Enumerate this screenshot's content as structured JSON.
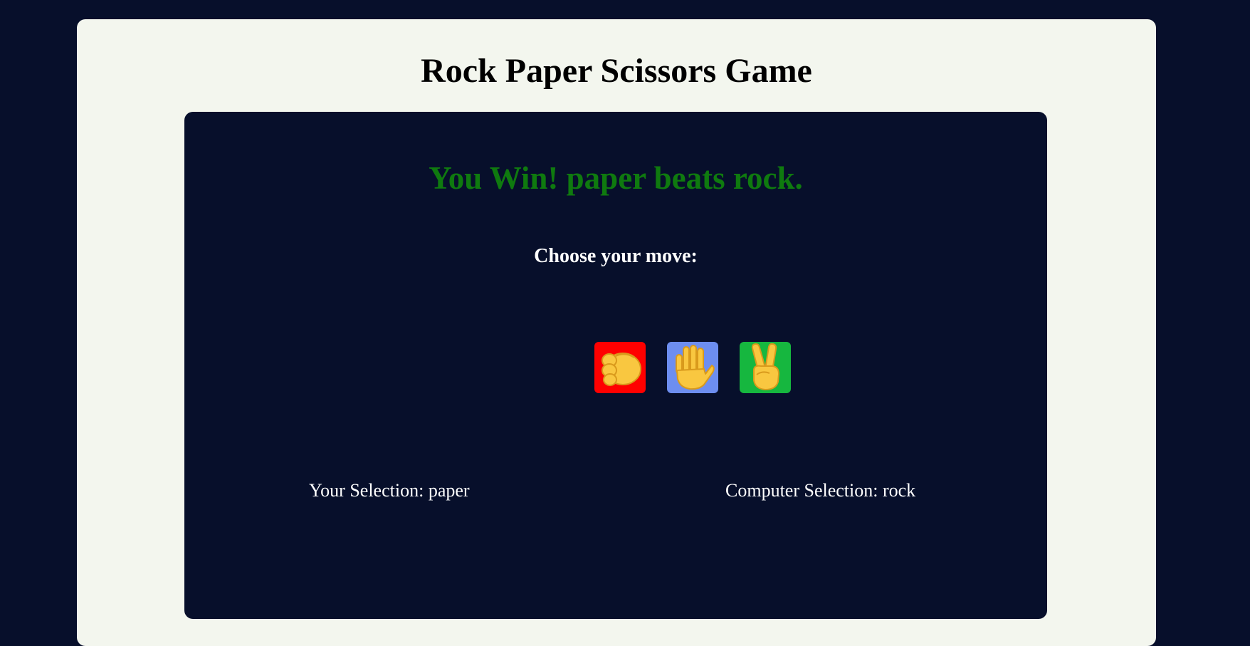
{
  "app": {
    "title": "Rock Paper Scissors Game"
  },
  "result": {
    "text": "You Win! paper beats rock.",
    "color": "#0f7a0f"
  },
  "prompt": {
    "text": "Choose your move:"
  },
  "moves": [
    {
      "label": "rock",
      "icon": "fist-icon",
      "color": "#ff0000"
    },
    {
      "label": "paper",
      "icon": "raised-hand-icon",
      "color": "#6d8ef0"
    },
    {
      "label": "scissors",
      "icon": "victory-hand-icon",
      "color": "#16b73f"
    }
  ],
  "selection": {
    "user_prefix": "Your Selection: ",
    "user_value": "paper",
    "computer_prefix": "Computer Selection: ",
    "computer_value": "rock"
  },
  "colors": {
    "background": "#070f2b",
    "card": "#f3f6ee",
    "panel": "#070f2b",
    "text_light": "#ffffff",
    "hand": "#f9c740"
  }
}
